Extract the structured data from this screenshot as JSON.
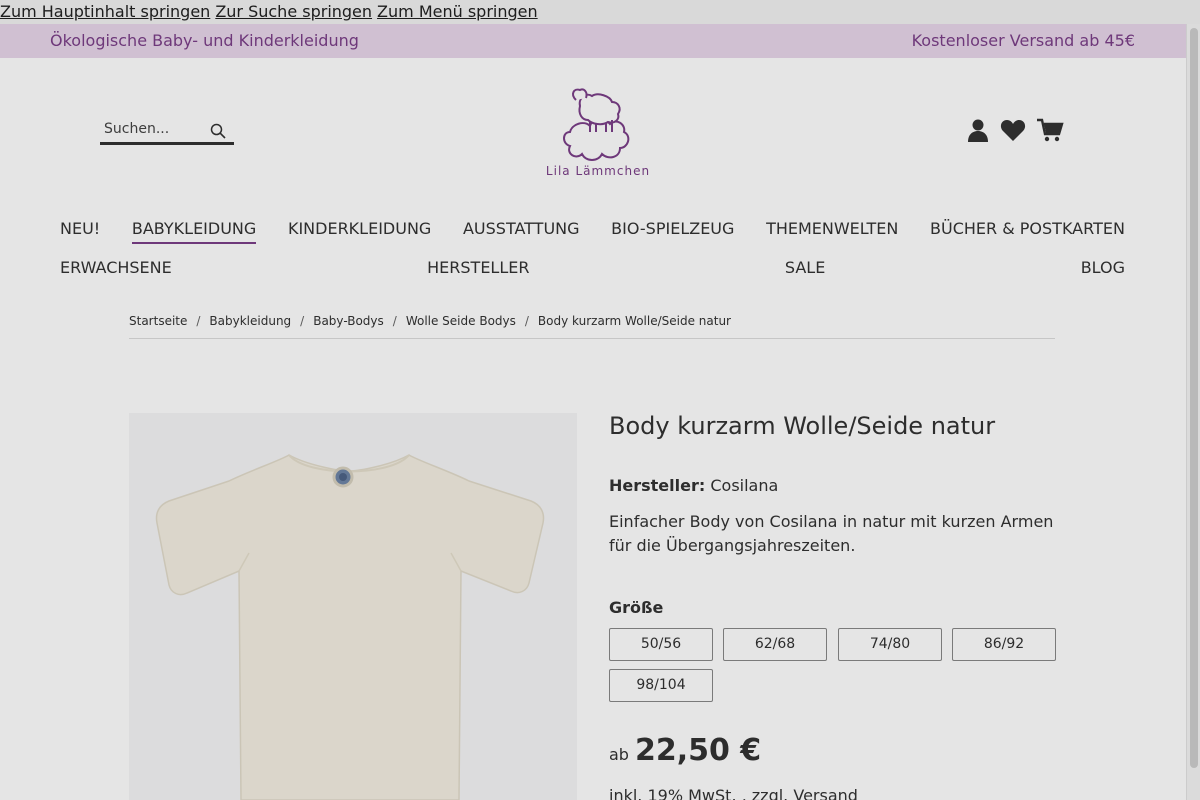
{
  "skip_links": [
    "Zum Hauptinhalt springen",
    "Zur Suche springen",
    "Zum Menü springen"
  ],
  "topbar": {
    "left": "Ökologische Baby- und Kinderkleidung",
    "right": "Kostenloser Versand ab 45€"
  },
  "search": {
    "placeholder": "Suchen..."
  },
  "logo": {
    "text": "Lila Lämmchen"
  },
  "header_icons": [
    "account-icon",
    "heart-icon",
    "cart-icon"
  ],
  "nav": {
    "row1": [
      "NEU!",
      "BABYKLEIDUNG",
      "KINDERKLEIDUNG",
      "AUSSTATTUNG",
      "BIO-SPIELZEUG",
      "THEMENWELTEN",
      "BÜCHER & POSTKARTEN"
    ],
    "row2": [
      "ERWACHSENE",
      "HERSTELLER",
      "SALE",
      "BLOG"
    ],
    "active": "BABYKLEIDUNG"
  },
  "breadcrumb": [
    "Startseite",
    "Babykleidung",
    "Baby-Bodys",
    "Wolle Seide Bodys",
    "Body kurzarm Wolle/Seide natur"
  ],
  "product": {
    "title": "Body kurzarm Wolle/Seide natur",
    "manufacturer_label": "Hersteller:",
    "manufacturer": "Cosilana",
    "description": "Einfacher Body von Cosilana in natur mit kurzen Armen für die Übergangsjahreszeiten.",
    "size_label": "Größe",
    "sizes": [
      "50/56",
      "62/68",
      "74/80",
      "86/92",
      "98/104"
    ],
    "price_prefix": "ab",
    "price": "22,50 €",
    "tax_text": "inkl. 19% MwSt. , zzgl.",
    "shipping_link": "Versand"
  },
  "colors": {
    "brand_purple": "#7b3f88",
    "topbar_bg": "#e8d6ea"
  }
}
